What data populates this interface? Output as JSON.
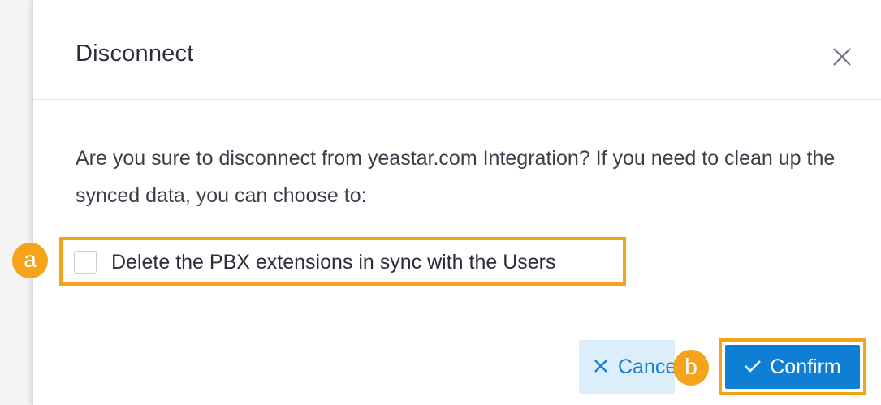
{
  "dialog": {
    "title": "Disconnect",
    "message": "Are you sure to disconnect from yeastar.com Integration? If you need to clean up the synced data, you can choose to:",
    "option": {
      "label": "Delete the PBX extensions in sync with the Users",
      "checked": false
    },
    "footer": {
      "cancel_label": "Cancel",
      "confirm_label": "Confirm"
    }
  },
  "callouts": {
    "a": "a",
    "b": "b"
  },
  "colors": {
    "highlight": "#f5a31a",
    "primary": "#0f7fd6",
    "secondary_bg": "#dbeefa",
    "secondary_text": "#1a7fd4"
  },
  "icons": {
    "close": "close-icon",
    "cancel": "x-icon",
    "confirm": "check-icon"
  }
}
